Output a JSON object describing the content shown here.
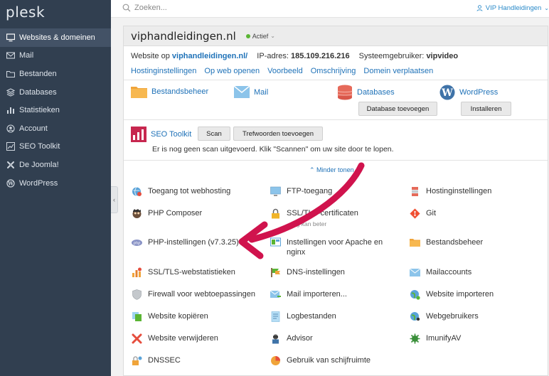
{
  "brand": "plesk",
  "sidebar": {
    "items": [
      {
        "label": "Websites & domeinen",
        "icon": "monitor-icon",
        "active": true
      },
      {
        "label": "Mail",
        "icon": "mail-icon"
      },
      {
        "label": "Bestanden",
        "icon": "folder-icon"
      },
      {
        "label": "Databases",
        "icon": "database-icon"
      },
      {
        "label": "Statistieken",
        "icon": "chart-icon"
      },
      {
        "label": "Account",
        "icon": "account-icon"
      },
      {
        "label": "SEO Toolkit",
        "icon": "seo-icon"
      },
      {
        "label": "De Joomla!",
        "icon": "joomla-icon"
      },
      {
        "label": "WordPress",
        "icon": "wordpress-icon"
      }
    ]
  },
  "topbar": {
    "search_placeholder": "Zoeken...",
    "user": "VIP Handleidingen"
  },
  "domain": {
    "name": "viphandleidingen.nl",
    "status": "Actief",
    "website_label": "Website op",
    "website_link": "viphandleidingen.nl/",
    "ip_label": "IP-adres:",
    "ip": "185.109.216.216",
    "sysuser_label": "Systeemgebruiker:",
    "sysuser": "vipvideo"
  },
  "quick_links": [
    "Hostinginstellingen",
    "Op web openen",
    "Voorbeeld",
    "Omschrijving",
    "Domein verplaatsen"
  ],
  "tools": {
    "filemanager": "Bestandsbeheer",
    "mail": "Mail",
    "databases": "Databases",
    "db_add_button": "Database toevoegen",
    "wordpress": "WordPress",
    "wp_install_button": "Installeren"
  },
  "seo": {
    "title": "SEO Toolkit",
    "scan_button": "Scan",
    "keywords_button": "Trefwoorden toevoegen",
    "message": "Er is nog geen scan uitgevoerd. Klik \"Scannen\" om uw site door te lopen."
  },
  "less_toggle": "Minder tonen",
  "grid": {
    "col1": [
      {
        "label": "Toegang tot webhosting",
        "icon": "webhosting-icon"
      },
      {
        "label": "PHP Composer",
        "icon": "composer-icon"
      },
      {
        "label": "PHP-instellingen (v7.3.25)",
        "icon": "php-icon"
      },
      {
        "label": "SSL/TLS-webstatistieken",
        "icon": "webstats-icon"
      },
      {
        "label": "Firewall voor webtoepassingen",
        "icon": "shield-icon"
      },
      {
        "label": "Website kopiëren",
        "icon": "copy-icon"
      },
      {
        "label": "Website verwijderen",
        "icon": "delete-icon"
      },
      {
        "label": "DNSSEC",
        "icon": "dnssec-icon"
      }
    ],
    "col2": [
      {
        "label": "FTP-toegang",
        "icon": "ftp-icon"
      },
      {
        "label": "SSL/TLS-certificaten",
        "sub": "...ing kan beter",
        "icon": "lock-icon"
      },
      {
        "label": "Instellingen voor Apache en nginx",
        "icon": "apache-icon"
      },
      {
        "label": "DNS-instellingen",
        "icon": "dns-icon"
      },
      {
        "label": "Mail importeren...",
        "icon": "mail-import-icon"
      },
      {
        "label": "Logbestanden",
        "icon": "log-icon"
      },
      {
        "label": "Advisor",
        "icon": "advisor-icon"
      },
      {
        "label": "Gebruik van schijfruimte",
        "icon": "disk-icon"
      }
    ],
    "col3": [
      {
        "label": "Hostinginstellingen",
        "icon": "hosting-settings-icon"
      },
      {
        "label": "Git",
        "icon": "git-icon"
      },
      {
        "label": "Bestandsbeheer",
        "icon": "folder-icon"
      },
      {
        "label": "Mailaccounts",
        "icon": "mailaccounts-icon"
      },
      {
        "label": "Website importeren",
        "icon": "globe-import-icon"
      },
      {
        "label": "Webgebruikers",
        "icon": "webusers-icon"
      },
      {
        "label": "ImunifyAV",
        "icon": "imunify-icon"
      }
    ]
  },
  "colors": {
    "sidebar": "#313f50",
    "link": "#1f72b8",
    "active_dot": "#5ab534",
    "arrow": "#d0134d"
  }
}
